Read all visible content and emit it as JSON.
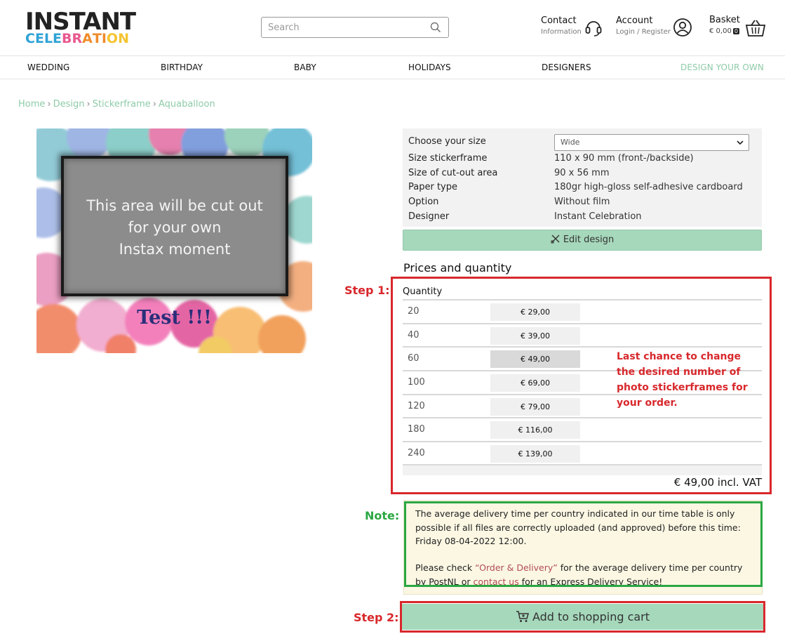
{
  "header": {
    "logo_line1": "INSTANT",
    "logo_line2_letters": [
      {
        "ch": "C",
        "color": "#2ea3d6"
      },
      {
        "ch": "E",
        "color": "#2ea3d6"
      },
      {
        "ch": "L",
        "color": "#2ea3d6"
      },
      {
        "ch": "E",
        "color": "#2ea3d6"
      },
      {
        "ch": "B",
        "color": "#e9578f"
      },
      {
        "ch": "R",
        "color": "#e9578f"
      },
      {
        "ch": "A",
        "color": "#f08b2b"
      },
      {
        "ch": "T",
        "color": "#f08b2b"
      },
      {
        "ch": "I",
        "color": "#f08b2b"
      },
      {
        "ch": "O",
        "color": "#f4c430"
      },
      {
        "ch": "N",
        "color": "#f4c430"
      }
    ],
    "search_placeholder": "Search",
    "contact_title": "Contact",
    "contact_sub": "Information",
    "account_title": "Account",
    "account_sub_login": "Login",
    "account_sub_sep": "/",
    "account_sub_register": "Register",
    "basket_title": "Basket",
    "basket_amount": "€ 0,00",
    "basket_count": "0"
  },
  "nav": {
    "items": [
      "WEDDING",
      "BIRTHDAY",
      "BABY",
      "HOLIDAYS",
      "DESIGNERS",
      "DESIGN YOUR OWN"
    ]
  },
  "breadcrumb": [
    "Home",
    "Design",
    "Stickerframe",
    "Aquaballoon"
  ],
  "product": {
    "cutout_lines": [
      "This area will be cut out",
      "for your own",
      "Instax moment"
    ],
    "custom_text": "Test !!!"
  },
  "spec": {
    "size_label": "Choose your size",
    "size_selected": "Wide",
    "rows": [
      {
        "label": "Size stickerframe",
        "value": "110 x 90 mm (front-/backside)"
      },
      {
        "label": "Size of cut-out area",
        "value": "90 x 56 mm"
      },
      {
        "label": "Paper type",
        "value": "180gr high-gloss self-adhesive cardboard"
      },
      {
        "label": "Option",
        "value": "Without film"
      },
      {
        "label": "Designer",
        "value": "Instant Celebration"
      }
    ],
    "edit_button": "Edit design"
  },
  "prices": {
    "title": "Prices and quantity",
    "quantity_header": "Quantity",
    "rows": [
      {
        "qty": "20",
        "price": "€ 29,00"
      },
      {
        "qty": "40",
        "price": "€ 39,00"
      },
      {
        "qty": "60",
        "price": "€ 49,00"
      },
      {
        "qty": "100",
        "price": "€ 69,00"
      },
      {
        "qty": "120",
        "price": "€ 79,00"
      },
      {
        "qty": "180",
        "price": "€ 116,00"
      },
      {
        "qty": "240",
        "price": "€ 139,00"
      }
    ],
    "selected_qty": "60",
    "total": "€ 49,00 incl. VAT"
  },
  "annotations": {
    "step1": "Step 1:",
    "step1_note": "Last chance to change the desired number of photo stickerframes for your order.",
    "note_label": "Note:",
    "step2": "Step 2:",
    "red": "#d8282c",
    "green": "#2ba743"
  },
  "notice": {
    "line1": "The average delivery time per country indicated in our time table is only possible if all files are correctly uploaded (and approved) before this time: Friday 08-04-2022 12:00.",
    "line2_pre": "Please check ",
    "line2_link1": "“Order & Delivery”",
    "line2_mid": " for the average delivery time per country by PostNL or ",
    "line2_link2": "contact us",
    "line2_post": " for an Express Delivery Service!"
  },
  "cart_button": "Add to shopping cart",
  "colors": {
    "accent_green": "#8ecba8",
    "button_green": "#a6d8bb",
    "notice_bg": "#fbf7e3",
    "link_red": "#b24a56"
  }
}
